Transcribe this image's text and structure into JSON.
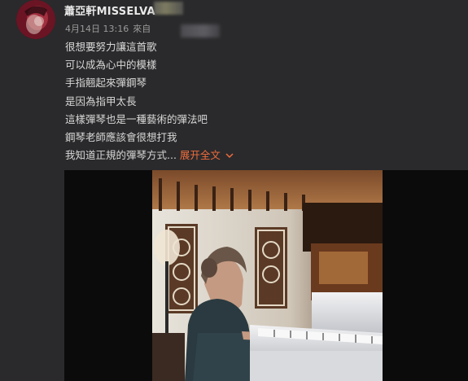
{
  "post": {
    "username": "蕭亞軒MISSELVA",
    "date": "4月14日 13:16",
    "source_prefix": "來自",
    "lines": [
      "很想要努力讓這首歌",
      "可以成為心中的模樣",
      "手指翹起來彈鋼琴",
      "是因為指甲太長",
      "這樣彈琴也是一種藝術的彈法吧",
      "鋼琴老師應該會很想打我",
      "我知道正規的彈琴方式..."
    ],
    "expand_label": "展开全文",
    "expand_icon": "chevron-down-icon"
  },
  "colors": {
    "background": "#2a2a2c",
    "accent": "#f06d3c"
  }
}
